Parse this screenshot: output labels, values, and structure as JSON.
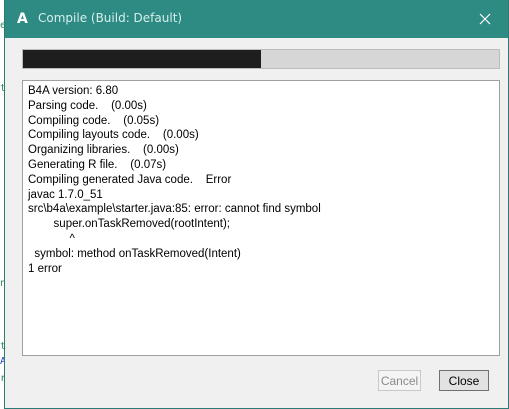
{
  "background": {
    "fragments": [
      {
        "text": "ec",
        "color": "#2e8b57"
      },
      {
        "text": "t",
        "color": "#2e8b57"
      },
      {
        "text": "n",
        "color": "#2e8b57"
      },
      {
        "text": "t",
        "color": "#2e8b57"
      },
      {
        "text": "As",
        "color": "#1e3cc8"
      },
      {
        "text": "ro",
        "color": "#2e8b57"
      }
    ]
  },
  "dialog": {
    "title": "Compile (Build: Default)",
    "app_icon_glyph": "A",
    "close_glyph": "✕",
    "progress": 0.5,
    "log_lines": [
      "B4A version: 6.80",
      "Parsing code.    (0.00s)",
      "Compiling code.    (0.05s)",
      "Compiling layouts code.    (0.00s)",
      "Organizing libraries.    (0.00s)",
      "Generating R file.    (0.07s)",
      "Compiling generated Java code.    Error",
      "javac 1.7.0_51",
      "src\\b4a\\example\\starter.java:85: error: cannot find symbol",
      "        super.onTaskRemoved(rootIntent);",
      "             ^",
      "  symbol: method onTaskRemoved(Intent)",
      "1 error"
    ],
    "buttons": {
      "cancel": "Cancel",
      "close": "Close"
    }
  },
  "colors": {
    "titlebar": "#2d8b84",
    "progress_fill": "#1e1e1e"
  },
  "icons": {
    "app": "b4a-app-icon",
    "close": "close-icon"
  }
}
